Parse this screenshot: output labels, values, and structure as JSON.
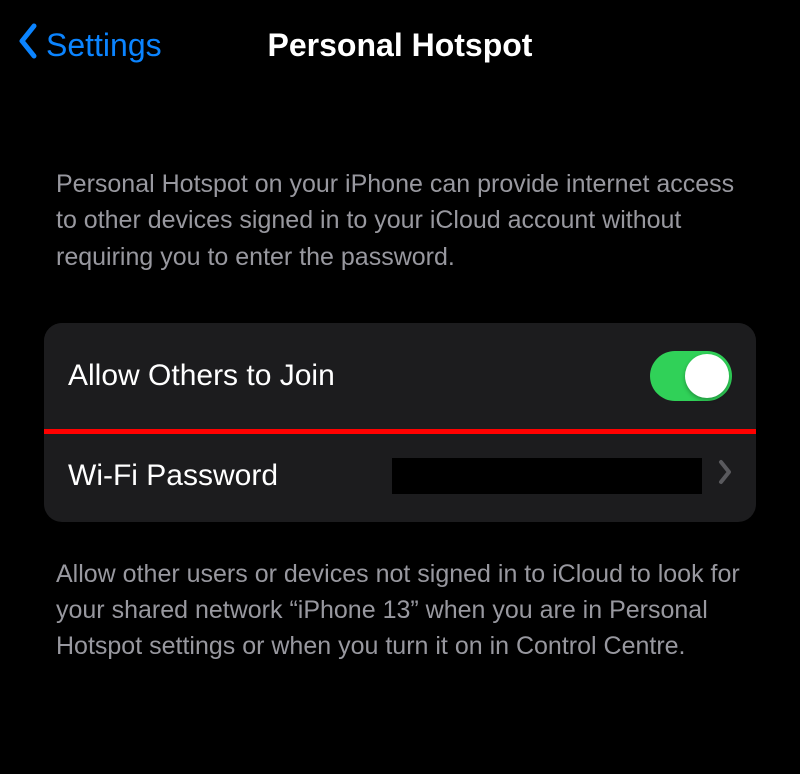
{
  "header": {
    "back_label": "Settings",
    "title": "Personal Hotspot"
  },
  "top_description": "Personal Hotspot on your iPhone can provide internet access to other devices signed in to your iCloud account without requiring you to enter the password.",
  "rows": {
    "allow_others": {
      "label": "Allow Others to Join",
      "switch_on": true
    },
    "wifi_password": {
      "label": "Wi-Fi Password"
    }
  },
  "bottom_description": "Allow other users or devices not signed in to iCloud to look for your shared network “iPhone 13” when you are in Personal Hotspot settings or when you turn it on in Control Centre."
}
